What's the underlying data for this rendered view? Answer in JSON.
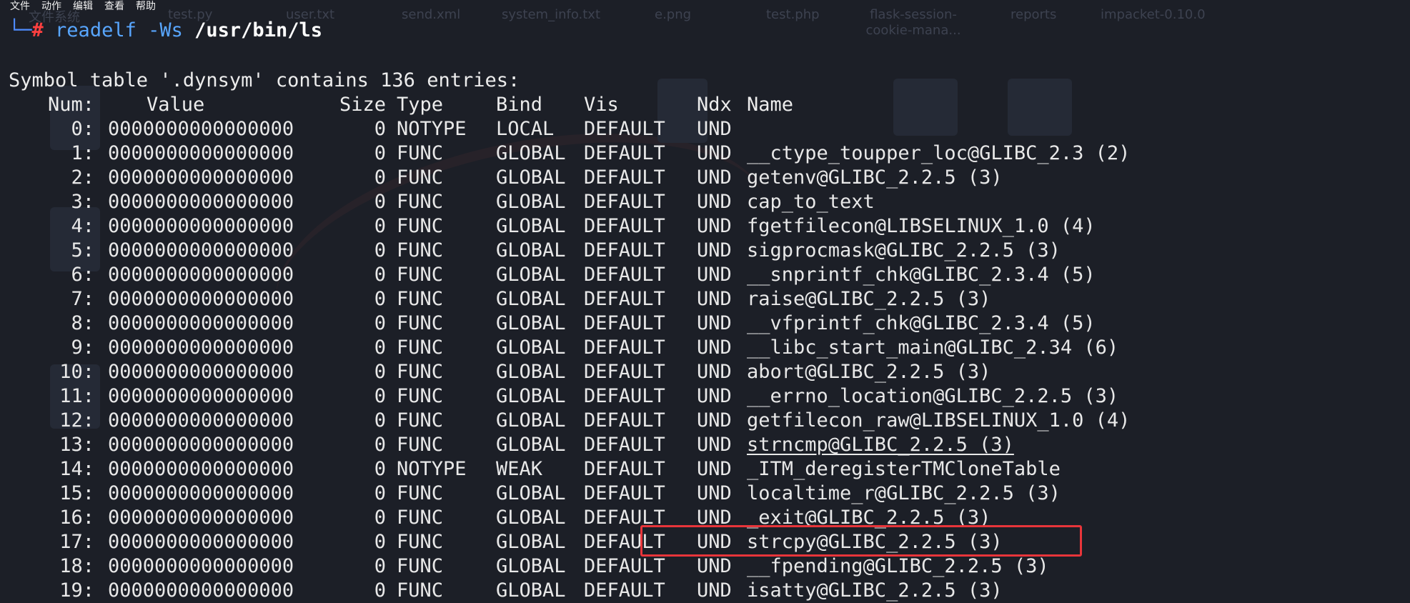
{
  "menubar": {
    "items": [
      "文件",
      "动作",
      "编辑",
      "查看",
      "帮助"
    ]
  },
  "desktop_ghost_files": [
    "文件系统",
    "test.py",
    "user.txt",
    "send.xml",
    "system_info.txt",
    "e.png",
    "test.php",
    "flask-session-cookie-mana...",
    "reports",
    "impacket-0.10.0"
  ],
  "prompt": {
    "corner": "└─",
    "symbol": "#",
    "command": "readelf",
    "flags": "-Ws",
    "path": "/usr/bin/ls"
  },
  "output": {
    "summary": "Symbol table '.dynsym' contains 136 entries:",
    "headers": {
      "num": "Num:",
      "value": "Value",
      "size": "Size",
      "type": "Type",
      "bind": "Bind",
      "vis": "Vis",
      "ndx": "Ndx",
      "name": "Name"
    },
    "rows": [
      {
        "num": "0:",
        "value": "0000000000000000",
        "size": "0",
        "type": "NOTYPE",
        "bind": "LOCAL",
        "vis": "DEFAULT",
        "ndx": "UND",
        "name": ""
      },
      {
        "num": "1:",
        "value": "0000000000000000",
        "size": "0",
        "type": "FUNC",
        "bind": "GLOBAL",
        "vis": "DEFAULT",
        "ndx": "UND",
        "name": "__ctype_toupper_loc@GLIBC_2.3 (2)"
      },
      {
        "num": "2:",
        "value": "0000000000000000",
        "size": "0",
        "type": "FUNC",
        "bind": "GLOBAL",
        "vis": "DEFAULT",
        "ndx": "UND",
        "name": "getenv@GLIBC_2.2.5 (3)"
      },
      {
        "num": "3:",
        "value": "0000000000000000",
        "size": "0",
        "type": "FUNC",
        "bind": "GLOBAL",
        "vis": "DEFAULT",
        "ndx": "UND",
        "name": "cap_to_text"
      },
      {
        "num": "4:",
        "value": "0000000000000000",
        "size": "0",
        "type": "FUNC",
        "bind": "GLOBAL",
        "vis": "DEFAULT",
        "ndx": "UND",
        "name": "fgetfilecon@LIBSELINUX_1.0 (4)"
      },
      {
        "num": "5:",
        "value": "0000000000000000",
        "size": "0",
        "type": "FUNC",
        "bind": "GLOBAL",
        "vis": "DEFAULT",
        "ndx": "UND",
        "name": "sigprocmask@GLIBC_2.2.5 (3)"
      },
      {
        "num": "6:",
        "value": "0000000000000000",
        "size": "0",
        "type": "FUNC",
        "bind": "GLOBAL",
        "vis": "DEFAULT",
        "ndx": "UND",
        "name": "__snprintf_chk@GLIBC_2.3.4 (5)"
      },
      {
        "num": "7:",
        "value": "0000000000000000",
        "size": "0",
        "type": "FUNC",
        "bind": "GLOBAL",
        "vis": "DEFAULT",
        "ndx": "UND",
        "name": "raise@GLIBC_2.2.5 (3)"
      },
      {
        "num": "8:",
        "value": "0000000000000000",
        "size": "0",
        "type": "FUNC",
        "bind": "GLOBAL",
        "vis": "DEFAULT",
        "ndx": "UND",
        "name": "__vfprintf_chk@GLIBC_2.3.4 (5)"
      },
      {
        "num": "9:",
        "value": "0000000000000000",
        "size": "0",
        "type": "FUNC",
        "bind": "GLOBAL",
        "vis": "DEFAULT",
        "ndx": "UND",
        "name": "__libc_start_main@GLIBC_2.34 (6)"
      },
      {
        "num": "10:",
        "value": "0000000000000000",
        "size": "0",
        "type": "FUNC",
        "bind": "GLOBAL",
        "vis": "DEFAULT",
        "ndx": "UND",
        "name": "abort@GLIBC_2.2.5 (3)"
      },
      {
        "num": "11:",
        "value": "0000000000000000",
        "size": "0",
        "type": "FUNC",
        "bind": "GLOBAL",
        "vis": "DEFAULT",
        "ndx": "UND",
        "name": "__errno_location@GLIBC_2.2.5 (3)"
      },
      {
        "num": "12:",
        "value": "0000000000000000",
        "size": "0",
        "type": "FUNC",
        "bind": "GLOBAL",
        "vis": "DEFAULT",
        "ndx": "UND",
        "name": "getfilecon_raw@LIBSELINUX_1.0 (4)"
      },
      {
        "num": "13:",
        "value": "0000000000000000",
        "size": "0",
        "type": "FUNC",
        "bind": "GLOBAL",
        "vis": "DEFAULT",
        "ndx": "UND",
        "name": "strncmp@GLIBC_2.2.5 (3)"
      },
      {
        "num": "14:",
        "value": "0000000000000000",
        "size": "0",
        "type": "NOTYPE",
        "bind": "WEAK",
        "vis": "DEFAULT",
        "ndx": "UND",
        "name": "_ITM_deregisterTMCloneTable"
      },
      {
        "num": "15:",
        "value": "0000000000000000",
        "size": "0",
        "type": "FUNC",
        "bind": "GLOBAL",
        "vis": "DEFAULT",
        "ndx": "UND",
        "name": "localtime_r@GLIBC_2.2.5 (3)"
      },
      {
        "num": "16:",
        "value": "0000000000000000",
        "size": "0",
        "type": "FUNC",
        "bind": "GLOBAL",
        "vis": "DEFAULT",
        "ndx": "UND",
        "name": "_exit@GLIBC_2.2.5 (3)"
      },
      {
        "num": "17:",
        "value": "0000000000000000",
        "size": "0",
        "type": "FUNC",
        "bind": "GLOBAL",
        "vis": "DEFAULT",
        "ndx": "UND",
        "name": "strcpy@GLIBC_2.2.5 (3)"
      },
      {
        "num": "18:",
        "value": "0000000000000000",
        "size": "0",
        "type": "FUNC",
        "bind": "GLOBAL",
        "vis": "DEFAULT",
        "ndx": "UND",
        "name": "__fpending@GLIBC_2.2.5 (3)"
      },
      {
        "num": "19:",
        "value": "0000000000000000",
        "size": "0",
        "type": "FUNC",
        "bind": "GLOBAL",
        "vis": "DEFAULT",
        "ndx": "UND",
        "name": "isatty@GLIBC_2.2.5 (3)"
      }
    ]
  },
  "annotation": {
    "highlight_color": "#e8353a",
    "highlighted_row": 17
  }
}
